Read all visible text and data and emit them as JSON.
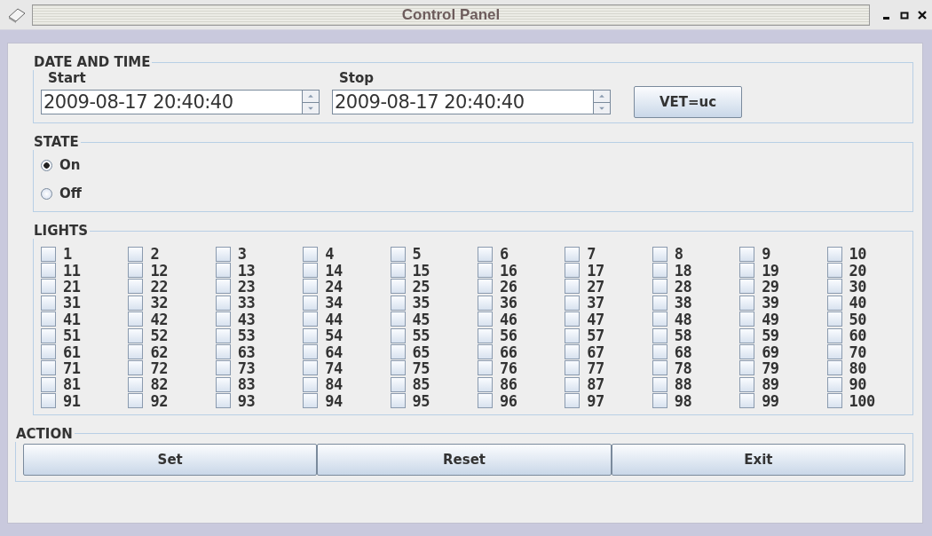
{
  "window": {
    "title": "Control Panel"
  },
  "date_time": {
    "title": "DATE AND TIME",
    "start": {
      "label": "Start",
      "value": "2009-08-17 20:40:40"
    },
    "stop": {
      "label": "Stop",
      "value": "2009-08-17 20:40:40"
    },
    "button": "VET=uc"
  },
  "state": {
    "title": "STATE",
    "options": [
      {
        "label": "On",
        "selected": true
      },
      {
        "label": "Off",
        "selected": false
      }
    ]
  },
  "lights": {
    "title": "LIGHTS",
    "items": [
      {
        "label": "1",
        "checked": false
      },
      {
        "label": "2",
        "checked": false
      },
      {
        "label": "3",
        "checked": false
      },
      {
        "label": "4",
        "checked": false
      },
      {
        "label": "5",
        "checked": false
      },
      {
        "label": "6",
        "checked": false
      },
      {
        "label": "7",
        "checked": false
      },
      {
        "label": "8",
        "checked": false
      },
      {
        "label": "9",
        "checked": false
      },
      {
        "label": "10",
        "checked": false
      },
      {
        "label": "11",
        "checked": false
      },
      {
        "label": "12",
        "checked": false
      },
      {
        "label": "13",
        "checked": false
      },
      {
        "label": "14",
        "checked": false
      },
      {
        "label": "15",
        "checked": false
      },
      {
        "label": "16",
        "checked": false
      },
      {
        "label": "17",
        "checked": false
      },
      {
        "label": "18",
        "checked": false
      },
      {
        "label": "19",
        "checked": false
      },
      {
        "label": "20",
        "checked": false
      },
      {
        "label": "21",
        "checked": false
      },
      {
        "label": "22",
        "checked": false
      },
      {
        "label": "23",
        "checked": false
      },
      {
        "label": "24",
        "checked": false
      },
      {
        "label": "25",
        "checked": false
      },
      {
        "label": "26",
        "checked": false
      },
      {
        "label": "27",
        "checked": false
      },
      {
        "label": "28",
        "checked": false
      },
      {
        "label": "29",
        "checked": false
      },
      {
        "label": "30",
        "checked": false
      },
      {
        "label": "31",
        "checked": false
      },
      {
        "label": "32",
        "checked": false
      },
      {
        "label": "33",
        "checked": false
      },
      {
        "label": "34",
        "checked": false
      },
      {
        "label": "35",
        "checked": false
      },
      {
        "label": "36",
        "checked": false
      },
      {
        "label": "37",
        "checked": false
      },
      {
        "label": "38",
        "checked": false
      },
      {
        "label": "39",
        "checked": false
      },
      {
        "label": "40",
        "checked": false
      },
      {
        "label": "41",
        "checked": false
      },
      {
        "label": "42",
        "checked": false
      },
      {
        "label": "43",
        "checked": false
      },
      {
        "label": "44",
        "checked": false
      },
      {
        "label": "45",
        "checked": false
      },
      {
        "label": "46",
        "checked": false
      },
      {
        "label": "47",
        "checked": false
      },
      {
        "label": "48",
        "checked": false
      },
      {
        "label": "49",
        "checked": false
      },
      {
        "label": "50",
        "checked": false
      },
      {
        "label": "51",
        "checked": false
      },
      {
        "label": "52",
        "checked": false
      },
      {
        "label": "53",
        "checked": false
      },
      {
        "label": "54",
        "checked": false
      },
      {
        "label": "55",
        "checked": false
      },
      {
        "label": "56",
        "checked": false
      },
      {
        "label": "57",
        "checked": false
      },
      {
        "label": "58",
        "checked": false
      },
      {
        "label": "59",
        "checked": false
      },
      {
        "label": "60",
        "checked": false
      },
      {
        "label": "61",
        "checked": false
      },
      {
        "label": "62",
        "checked": false
      },
      {
        "label": "63",
        "checked": false
      },
      {
        "label": "64",
        "checked": false
      },
      {
        "label": "65",
        "checked": false
      },
      {
        "label": "66",
        "checked": false
      },
      {
        "label": "67",
        "checked": false
      },
      {
        "label": "68",
        "checked": false
      },
      {
        "label": "69",
        "checked": false
      },
      {
        "label": "70",
        "checked": false
      },
      {
        "label": "71",
        "checked": false
      },
      {
        "label": "72",
        "checked": false
      },
      {
        "label": "73",
        "checked": false
      },
      {
        "label": "74",
        "checked": false
      },
      {
        "label": "75",
        "checked": false
      },
      {
        "label": "76",
        "checked": false
      },
      {
        "label": "77",
        "checked": false
      },
      {
        "label": "78",
        "checked": false
      },
      {
        "label": "79",
        "checked": false
      },
      {
        "label": "80",
        "checked": false
      },
      {
        "label": "81",
        "checked": false
      },
      {
        "label": "82",
        "checked": false
      },
      {
        "label": "83",
        "checked": false
      },
      {
        "label": "84",
        "checked": false
      },
      {
        "label": "85",
        "checked": false
      },
      {
        "label": "86",
        "checked": false
      },
      {
        "label": "87",
        "checked": false
      },
      {
        "label": "88",
        "checked": false
      },
      {
        "label": "89",
        "checked": false
      },
      {
        "label": "90",
        "checked": false
      },
      {
        "label": "91",
        "checked": false
      },
      {
        "label": "92",
        "checked": false
      },
      {
        "label": "93",
        "checked": false
      },
      {
        "label": "94",
        "checked": false
      },
      {
        "label": "95",
        "checked": false
      },
      {
        "label": "96",
        "checked": false
      },
      {
        "label": "97",
        "checked": false
      },
      {
        "label": "98",
        "checked": false
      },
      {
        "label": "99",
        "checked": false
      },
      {
        "label": "100",
        "checked": false
      }
    ]
  },
  "action": {
    "title": "ACTION",
    "buttons": [
      "Set",
      "Reset",
      "Exit"
    ]
  }
}
